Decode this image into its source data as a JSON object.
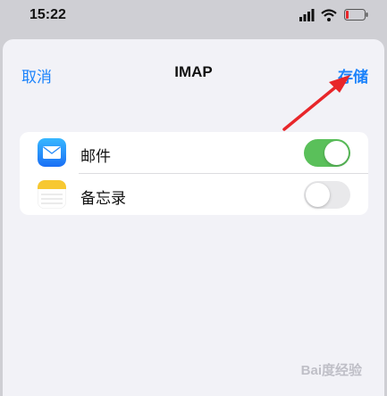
{
  "status_bar": {
    "time": "15:22",
    "icons": [
      "signal-icon",
      "wifi-icon",
      "battery-low-icon"
    ]
  },
  "nav": {
    "cancel_label": "取消",
    "title": "IMAP",
    "save_label": "存储"
  },
  "sync_options": [
    {
      "label": "邮件",
      "icon": "mail-icon",
      "enabled": true
    },
    {
      "label": "备忘录",
      "icon": "notes-icon",
      "enabled": false
    }
  ],
  "colors": {
    "accent": "#1a82fb",
    "toggle_on": "#5ac05a",
    "toggle_off": "#e9e9eb",
    "annotation": "#e8262a"
  },
  "watermark": "Bai度经验"
}
